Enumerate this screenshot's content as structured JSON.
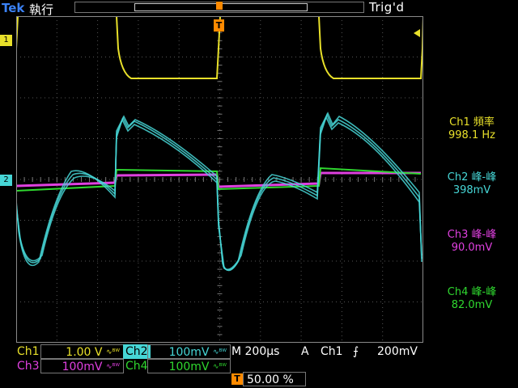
{
  "header": {
    "brand": "Tek",
    "run_state": "執行",
    "trigger_state": "Trig'd"
  },
  "markers": {
    "ch1": "1",
    "ch2": "2",
    "trigger": "T"
  },
  "measurements": [
    {
      "label": "Ch1 頻率",
      "value": "998.1 Hz",
      "color": "#e8e02a"
    },
    {
      "label": "Ch2 峰-峰",
      "value": "398mV",
      "color": "#46d6d6"
    },
    {
      "label": "Ch3 峰-峰",
      "value": "90.0mV",
      "color": "#e040e0"
    },
    {
      "label": "Ch4 峰-峰",
      "value": "82.0mV",
      "color": "#2fd82f"
    }
  ],
  "readout": {
    "ch1_label": "Ch1",
    "ch1_scale": "1.00 V",
    "ch2_label": "Ch2",
    "ch2_scale": "100mV",
    "ch3_label": "Ch3",
    "ch3_scale": "100mV",
    "ch4_label": "Ch4",
    "ch4_scale": "100mV",
    "bw_symbol": "∿ᴮᵂ",
    "timebase": "M 200µs",
    "acq_mode": "A",
    "trigger_source": "Ch1",
    "trigger_slope": "⨍",
    "trigger_level": "200mV",
    "trigger_position_icon": "T",
    "trigger_position": "50.00 %"
  },
  "colors": {
    "ch1": "#e8e02a",
    "ch2": "#46d6d6",
    "ch3": "#e040e0",
    "ch4": "#2fd82f",
    "trigger": "#ff8a00",
    "brand": "#3b82f6"
  }
}
